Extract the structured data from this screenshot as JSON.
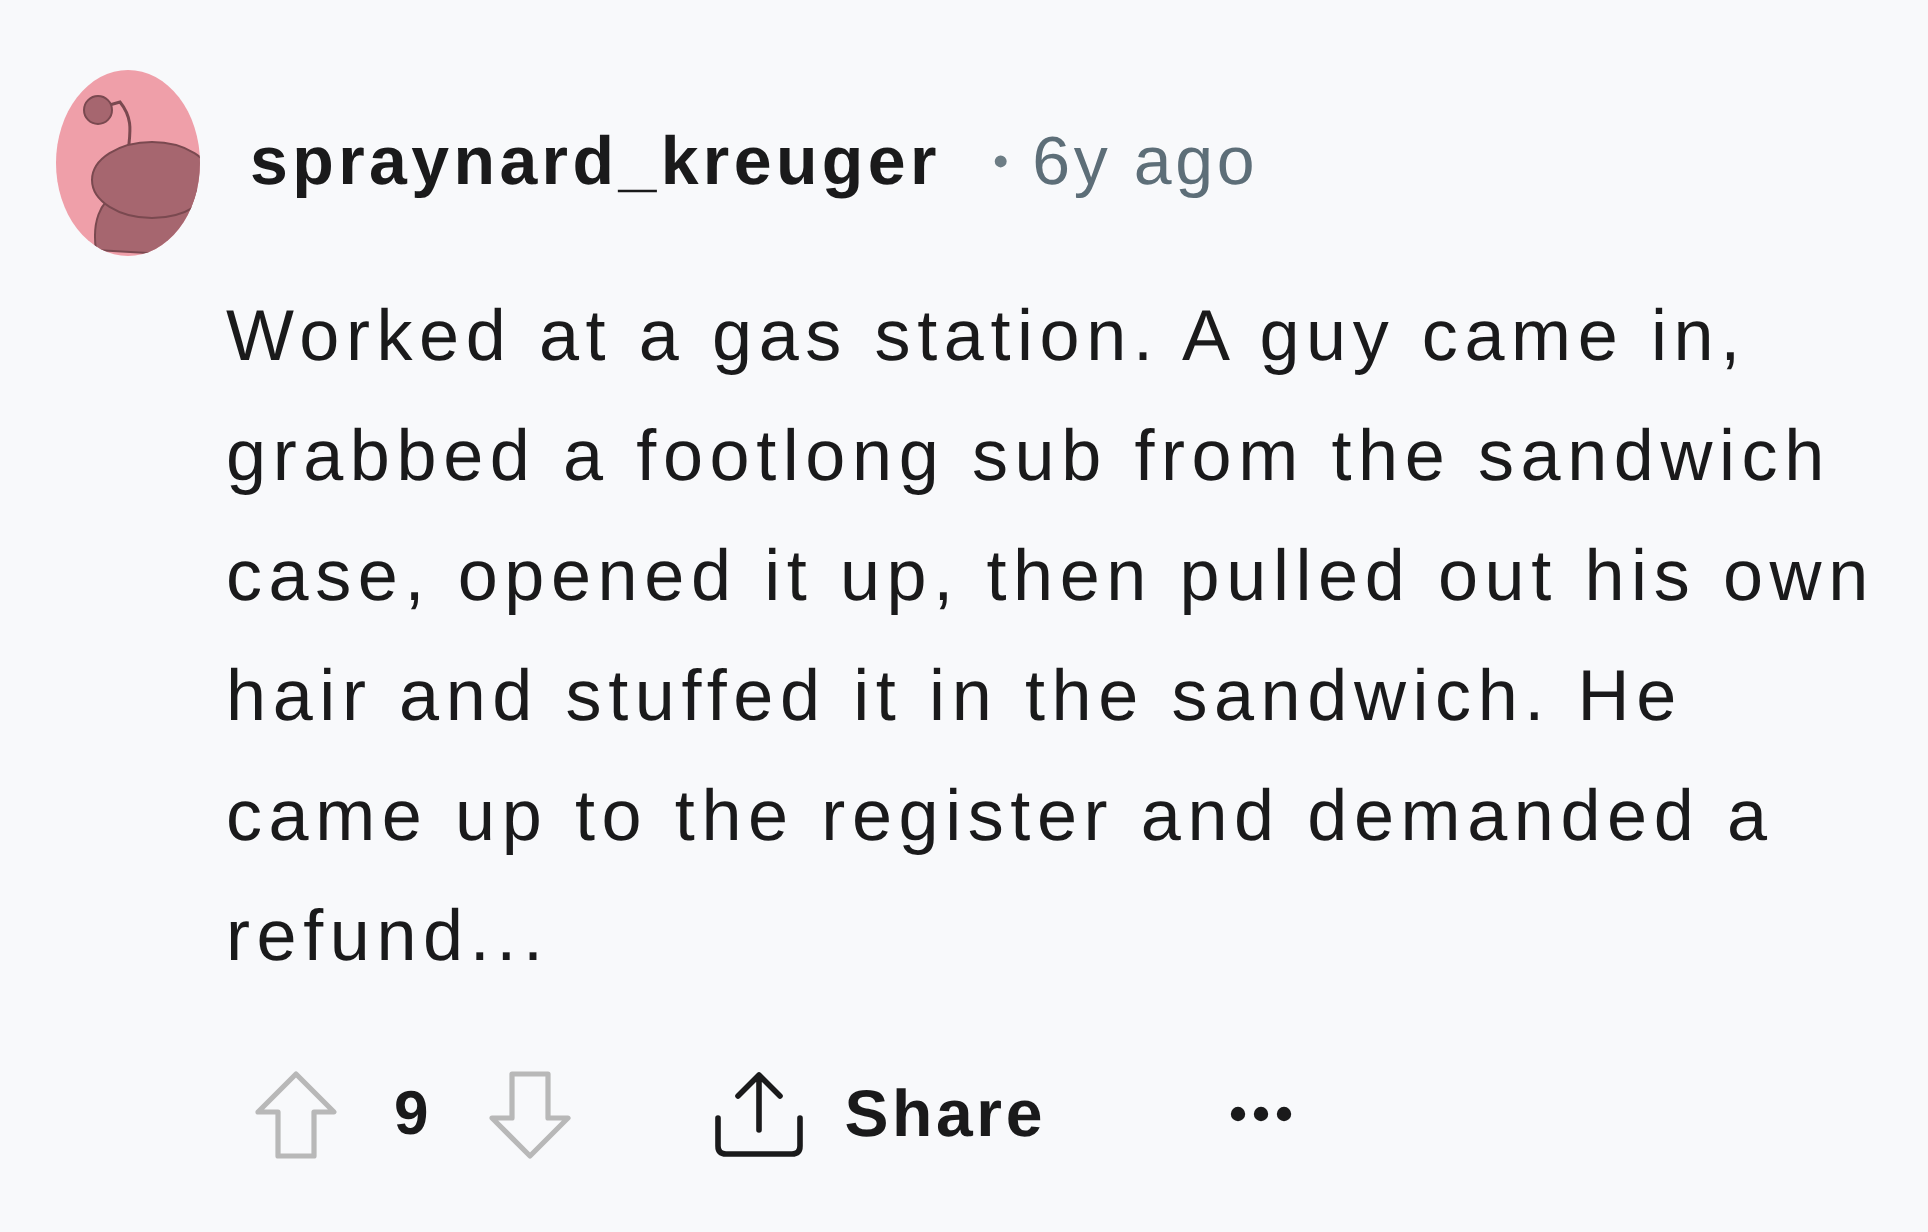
{
  "comment": {
    "author": "spraynard_kreuger",
    "separator": "•",
    "time": "6y ago",
    "body": "Worked at a gas station. A guy came in, grabbed a footlong sub from the sandwich case, opened it up, then pulled out his own hair and stuffed it in the sandwich. He came up to the register and demanded a refund...",
    "actions": {
      "score": "9",
      "share": "Share"
    }
  }
}
